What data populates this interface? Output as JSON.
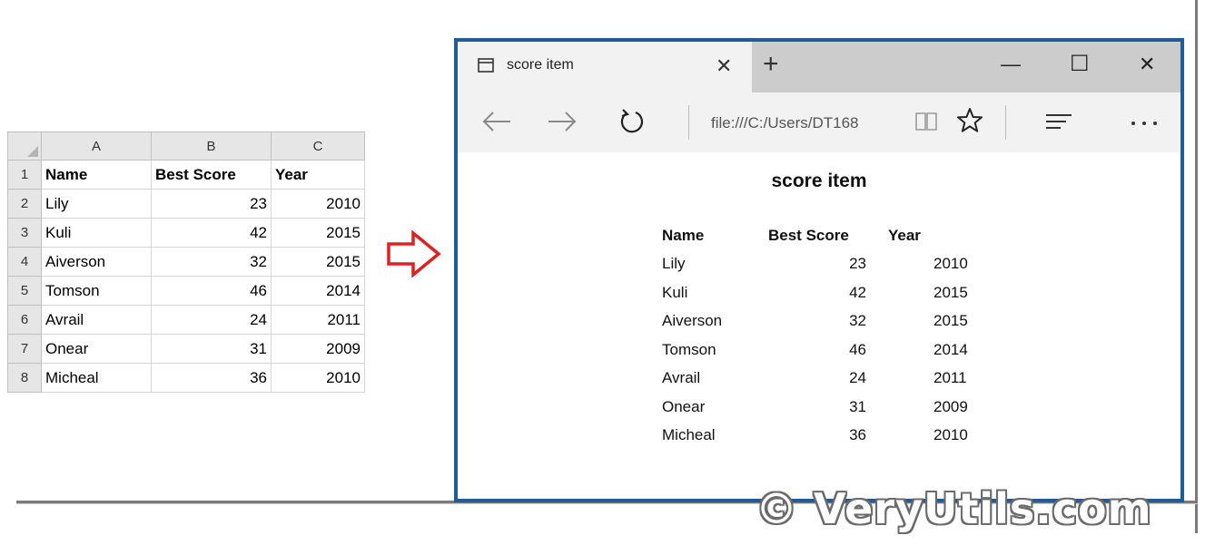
{
  "spreadsheet": {
    "columns": [
      "A",
      "B",
      "C"
    ],
    "row_numbers": [
      "1",
      "2",
      "3",
      "4",
      "5",
      "6",
      "7",
      "8"
    ],
    "header": [
      "Name",
      "Best Score",
      "Year"
    ],
    "rows": [
      [
        "Lily",
        "23",
        "2010"
      ],
      [
        "Kuli",
        "42",
        "2015"
      ],
      [
        "Aiverson",
        "32",
        "2015"
      ],
      [
        "Tomson",
        "46",
        "2014"
      ],
      [
        "Avrail",
        "24",
        "2011"
      ],
      [
        "Onear",
        "31",
        "2009"
      ],
      [
        "Micheal",
        "36",
        "2010"
      ]
    ]
  },
  "arrow": {
    "icon": "right-arrow-icon",
    "color": "#e02020"
  },
  "browser": {
    "tab_title": "score item",
    "tab_icon": "window-icon",
    "close_tab_glyph": "✕",
    "new_tab_glyph": "+",
    "window_controls": {
      "minimize": "—",
      "maximize": "☐",
      "close": "✕"
    },
    "address": "file:///C:/Users/DT168",
    "accent_color": "#1f5c99",
    "page": {
      "title": "score item",
      "header": [
        "Name",
        "Best Score",
        "Year"
      ],
      "rows": [
        [
          "Lily",
          "23",
          "2010"
        ],
        [
          "Kuli",
          "42",
          "2015"
        ],
        [
          "Aiverson",
          "32",
          "2015"
        ],
        [
          "Tomson",
          "46",
          "2014"
        ],
        [
          "Avrail",
          "24",
          "2011"
        ],
        [
          "Onear",
          "31",
          "2009"
        ],
        [
          "Micheal",
          "36",
          "2010"
        ]
      ]
    }
  },
  "watermark": "© VeryUtils.com"
}
